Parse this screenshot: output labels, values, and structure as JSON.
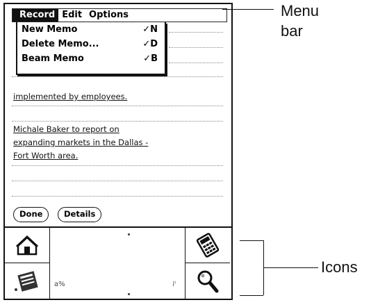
{
  "menu": {
    "items": [
      {
        "label": "Record"
      },
      {
        "label": "Edit"
      },
      {
        "label": "Options"
      }
    ]
  },
  "dropdown": {
    "items": [
      {
        "label": "New Memo",
        "shortcut": "✓N"
      },
      {
        "label": "Delete Memo...",
        "shortcut": "✓D"
      },
      {
        "label": "Beam Memo",
        "shortcut": "✓B"
      }
    ]
  },
  "memo": {
    "lines": [
      "implemented by employees.",
      "Michale Baker to report on",
      "expanding markets in the Dallas -",
      "Fort Worth area."
    ]
  },
  "buttons": {
    "done": "Done",
    "details": "Details"
  },
  "callouts": {
    "menu_bar_line1": "Menu",
    "menu_bar_line2": "bar",
    "icons": "Icons"
  },
  "silkscreen": {
    "icons": [
      "home-icon",
      "calculator-icon",
      "menu-icon",
      "find-icon"
    ]
  }
}
